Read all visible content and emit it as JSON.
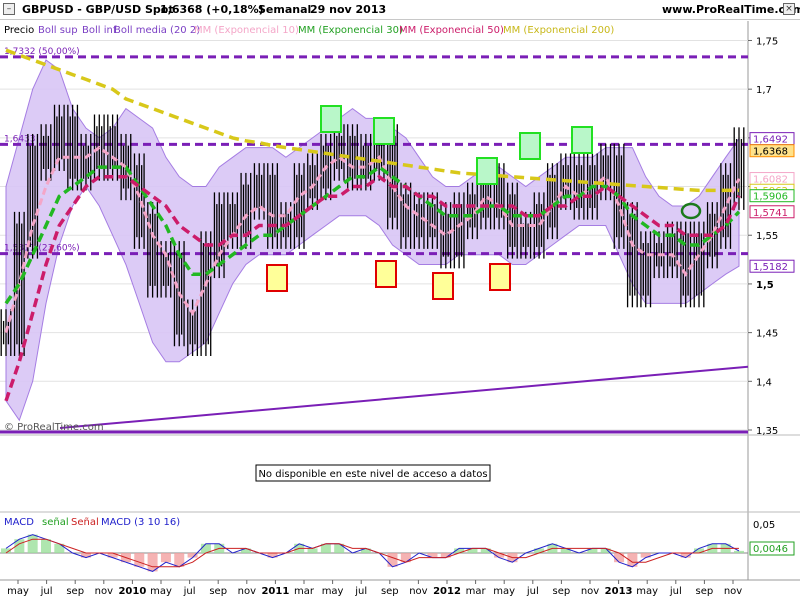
{
  "header": {
    "symbol": "GBPUSD - GBP/USD Spot",
    "last": "1,6368 (+0,18%)",
    "period": "Semanal",
    "date": "29 nov 2013",
    "site": "www.ProRealTime.com"
  },
  "legend": {
    "price": "Precio",
    "boll_sup": "Boll sup",
    "boll_inf": "Boll inf",
    "boll_media": "Boll media (20 2)",
    "mm10": "MM (Exponencial 10)",
    "mm30": "MM (Exponencial 30)",
    "mm50": "MM (Exponencial 50)",
    "mm200": "MM (Exponencial 200)"
  },
  "watermark": "© ProRealTime.com",
  "fib_labels": [
    "1,7332 (50,00%)",
    "1,6433",
    "1,5311 (23,60%)"
  ],
  "middle_panel": {
    "message": "No disponible en este nivel de acceso a datos"
  },
  "macd_panel": {
    "legend_macd": "MACD",
    "legend_senal": "señal",
    "legend_senal2": "Señal",
    "legend_params": "MACD (3 10 16)",
    "axis_labels": [
      "0,05",
      "0,0046"
    ]
  },
  "colors": {
    "band_fill": "#d9c6f6",
    "band_line": "#9c6fe0",
    "mm10": "#f4a6c8",
    "mm30": "#22b822",
    "mm50": "#cc1c6a",
    "mm200": "#d8c81a",
    "fib": "#7a1fb6",
    "support_up": "#22e022",
    "support_down": "#e00000",
    "box_fill": "#ffff99"
  },
  "chart_data": [
    {
      "type": "line",
      "title": "GBPUSD - GBP/USD Spot",
      "y_axis_labels": [
        "1,75",
        "1,7",
        "1,65",
        "1,6",
        "1,55",
        "1,5",
        "1,45",
        "1,4",
        "1,35"
      ],
      "ylim": [
        1.35,
        1.77
      ],
      "price_tags": [
        "1,6492",
        "1,6368",
        "1,6082",
        "1,5962",
        "1,5906",
        "1,5741",
        "1,5182"
      ],
      "x_tick_labels": [
        "may",
        "jul",
        "sep",
        "nov",
        "2010",
        "may",
        "jul",
        "sep",
        "nov",
        "2011",
        "mar",
        "may",
        "jul",
        "sep",
        "nov",
        "2012",
        "mar",
        "may",
        "jul",
        "sep",
        "nov",
        "2013",
        "may",
        "jul",
        "sep",
        "nov"
      ],
      "horizontal_levels": [
        1.7332,
        1.6433,
        1.5311
      ],
      "series": [
        {
          "name": "Precio",
          "x": [
            "2009-04",
            "2009-05",
            "2009-06",
            "2009-07",
            "2009-08",
            "2009-09",
            "2009-10",
            "2009-11",
            "2009-12",
            "2010-01",
            "2010-02",
            "2010-03",
            "2010-04",
            "2010-05",
            "2010-06",
            "2010-07",
            "2010-08",
            "2010-09",
            "2010-10",
            "2010-11",
            "2010-12",
            "2011-01",
            "2011-02",
            "2011-03",
            "2011-04",
            "2011-05",
            "2011-06",
            "2011-07",
            "2011-08",
            "2011-09",
            "2011-10",
            "2011-11",
            "2011-12",
            "2012-01",
            "2012-02",
            "2012-03",
            "2012-04",
            "2012-05",
            "2012-06",
            "2012-07",
            "2012-08",
            "2012-09",
            "2012-10",
            "2012-11",
            "2012-12",
            "2013-01",
            "2013-02",
            "2013-03",
            "2013-04",
            "2013-05",
            "2013-06",
            "2013-07",
            "2013-08",
            "2013-09",
            "2013-10",
            "2013-11"
          ],
          "values": [
            1.45,
            1.55,
            1.63,
            1.64,
            1.66,
            1.62,
            1.63,
            1.65,
            1.63,
            1.61,
            1.56,
            1.51,
            1.52,
            1.46,
            1.45,
            1.53,
            1.57,
            1.56,
            1.59,
            1.6,
            1.56,
            1.56,
            1.6,
            1.61,
            1.63,
            1.64,
            1.62,
            1.63,
            1.64,
            1.58,
            1.56,
            1.57,
            1.56,
            1.54,
            1.57,
            1.58,
            1.6,
            1.58,
            1.55,
            1.55,
            1.57,
            1.6,
            1.61,
            1.59,
            1.61,
            1.62,
            1.56,
            1.5,
            1.53,
            1.53,
            1.54,
            1.5,
            1.54,
            1.56,
            1.6,
            1.6368
          ]
        },
        {
          "name": "Boll sup",
          "values": [
            1.6,
            1.65,
            1.7,
            1.73,
            1.72,
            1.68,
            1.66,
            1.65,
            1.66,
            1.68,
            1.67,
            1.66,
            1.63,
            1.61,
            1.6,
            1.6,
            1.62,
            1.63,
            1.64,
            1.64,
            1.64,
            1.63,
            1.64,
            1.65,
            1.66,
            1.67,
            1.68,
            1.67,
            1.67,
            1.66,
            1.65,
            1.63,
            1.61,
            1.6,
            1.6,
            1.61,
            1.62,
            1.62,
            1.61,
            1.6,
            1.61,
            1.62,
            1.63,
            1.63,
            1.63,
            1.64,
            1.64,
            1.64,
            1.61,
            1.59,
            1.58,
            1.58,
            1.59,
            1.61,
            1.63,
            1.6492
          ]
        },
        {
          "name": "Boll inf",
          "values": [
            1.38,
            1.36,
            1.4,
            1.48,
            1.54,
            1.58,
            1.6,
            1.58,
            1.55,
            1.52,
            1.48,
            1.44,
            1.42,
            1.42,
            1.43,
            1.44,
            1.47,
            1.5,
            1.52,
            1.53,
            1.53,
            1.53,
            1.54,
            1.55,
            1.56,
            1.57,
            1.57,
            1.57,
            1.56,
            1.54,
            1.53,
            1.52,
            1.52,
            1.52,
            1.53,
            1.53,
            1.53,
            1.53,
            1.52,
            1.52,
            1.53,
            1.54,
            1.55,
            1.56,
            1.56,
            1.56,
            1.53,
            1.5,
            1.48,
            1.48,
            1.48,
            1.48,
            1.49,
            1.5,
            1.51,
            1.5182
          ]
        },
        {
          "name": "MM (Exponencial 10)",
          "values": [
            1.45,
            1.5,
            1.56,
            1.6,
            1.63,
            1.63,
            1.63,
            1.64,
            1.63,
            1.62,
            1.59,
            1.55,
            1.53,
            1.49,
            1.47,
            1.5,
            1.53,
            1.55,
            1.57,
            1.58,
            1.57,
            1.57,
            1.59,
            1.6,
            1.62,
            1.63,
            1.62,
            1.62,
            1.63,
            1.6,
            1.58,
            1.57,
            1.56,
            1.55,
            1.56,
            1.57,
            1.59,
            1.58,
            1.56,
            1.56,
            1.56,
            1.58,
            1.6,
            1.59,
            1.6,
            1.61,
            1.58,
            1.54,
            1.53,
            1.53,
            1.53,
            1.51,
            1.53,
            1.55,
            1.58,
            1.6082
          ]
        },
        {
          "name": "MM (Exponencial 30)",
          "values": [
            1.48,
            1.5,
            1.53,
            1.56,
            1.59,
            1.6,
            1.61,
            1.62,
            1.62,
            1.62,
            1.6,
            1.58,
            1.56,
            1.53,
            1.51,
            1.51,
            1.52,
            1.53,
            1.54,
            1.55,
            1.55,
            1.56,
            1.57,
            1.58,
            1.59,
            1.6,
            1.61,
            1.61,
            1.62,
            1.61,
            1.6,
            1.59,
            1.58,
            1.57,
            1.57,
            1.57,
            1.58,
            1.58,
            1.57,
            1.57,
            1.57,
            1.58,
            1.59,
            1.59,
            1.6,
            1.6,
            1.59,
            1.57,
            1.56,
            1.55,
            1.55,
            1.54,
            1.54,
            1.55,
            1.56,
            1.5741
          ]
        },
        {
          "name": "MM (Exponencial 50)",
          "values": [
            1.38,
            1.42,
            1.47,
            1.52,
            1.56,
            1.58,
            1.6,
            1.61,
            1.61,
            1.61,
            1.6,
            1.59,
            1.58,
            1.56,
            1.55,
            1.54,
            1.54,
            1.55,
            1.55,
            1.56,
            1.56,
            1.56,
            1.57,
            1.58,
            1.59,
            1.59,
            1.6,
            1.6,
            1.61,
            1.6,
            1.6,
            1.59,
            1.59,
            1.58,
            1.58,
            1.58,
            1.58,
            1.58,
            1.58,
            1.57,
            1.57,
            1.58,
            1.58,
            1.59,
            1.59,
            1.6,
            1.59,
            1.58,
            1.57,
            1.56,
            1.56,
            1.55,
            1.55,
            1.55,
            1.56,
            1.5906
          ]
        },
        {
          "name": "MM (Exponencial 200)",
          "values": [
            1.74,
            1.735,
            1.73,
            1.725,
            1.72,
            1.715,
            1.71,
            1.705,
            1.7,
            1.69,
            1.685,
            1.68,
            1.675,
            1.67,
            1.665,
            1.66,
            1.655,
            1.65,
            1.647,
            1.645,
            1.642,
            1.64,
            1.638,
            1.636,
            1.634,
            1.632,
            1.63,
            1.628,
            1.626,
            1.624,
            1.622,
            1.62,
            1.618,
            1.616,
            1.614,
            1.613,
            1.612,
            1.611,
            1.61,
            1.609,
            1.608,
            1.607,
            1.606,
            1.605,
            1.604,
            1.603,
            1.602,
            1.601,
            1.6,
            1.599,
            1.598,
            1.597,
            1.596,
            1.596,
            1.596,
            1.5962
          ]
        }
      ]
    },
    {
      "type": "bar",
      "title": "MACD (3 10 16)",
      "ylabel": "",
      "ylim": [
        -0.05,
        0.05
      ],
      "series": [
        {
          "name": "MACD",
          "values": [
            0.01,
            0.03,
            0.04,
            0.03,
            0.02,
            0.0,
            -0.01,
            0.0,
            -0.01,
            -0.02,
            -0.03,
            -0.04,
            -0.02,
            -0.03,
            -0.01,
            0.02,
            0.02,
            0.0,
            0.01,
            0.0,
            -0.01,
            0.0,
            0.02,
            0.01,
            0.02,
            0.02,
            0.0,
            0.01,
            0.0,
            -0.03,
            -0.02,
            0.0,
            -0.01,
            -0.01,
            0.01,
            0.01,
            0.01,
            -0.01,
            -0.02,
            0.0,
            0.01,
            0.02,
            0.01,
            0.0,
            0.01,
            0.01,
            -0.02,
            -0.03,
            -0.01,
            0.0,
            0.0,
            -0.01,
            0.01,
            0.02,
            0.02,
            0.0046
          ]
        },
        {
          "name": "Señal",
          "values": [
            0.0,
            0.02,
            0.03,
            0.03,
            0.02,
            0.01,
            0.0,
            0.0,
            0.0,
            -0.01,
            -0.02,
            -0.03,
            -0.03,
            -0.03,
            -0.02,
            0.0,
            0.01,
            0.01,
            0.01,
            0.0,
            0.0,
            0.0,
            0.01,
            0.01,
            0.02,
            0.02,
            0.01,
            0.01,
            0.0,
            -0.01,
            -0.02,
            -0.01,
            -0.01,
            -0.01,
            0.0,
            0.01,
            0.01,
            0.0,
            -0.01,
            -0.01,
            0.0,
            0.01,
            0.01,
            0.01,
            0.01,
            0.01,
            0.0,
            -0.02,
            -0.02,
            -0.01,
            0.0,
            0.0,
            0.0,
            0.01,
            0.01,
            0.01
          ]
        }
      ]
    }
  ]
}
